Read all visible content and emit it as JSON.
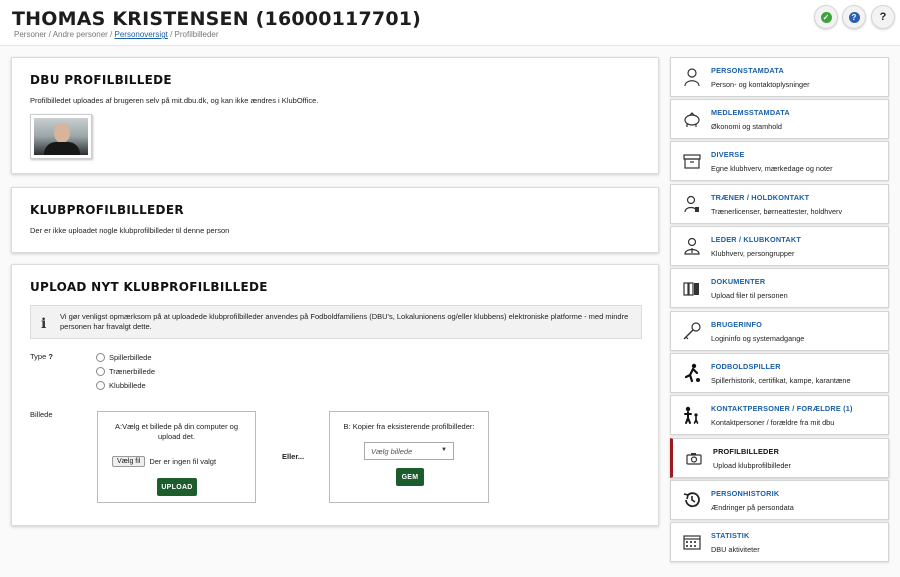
{
  "header": {
    "title": "THOMAS KRISTENSEN (16000117701)",
    "breadcrumb": {
      "part1": "Personer / Andre personer / ",
      "link": "Personoversigt",
      "part3": " / Profilbilleder"
    },
    "buttons": [
      {
        "icon": "green-circle-icon",
        "color": "#3aa33a",
        "glyph": "✓"
      },
      {
        "icon": "help-circle-icon",
        "color": "#2b5fb0",
        "glyph": "?"
      },
      {
        "icon": "question-icon",
        "glyph": "?"
      }
    ]
  },
  "panels": {
    "dbu": {
      "title": "DBU PROFILBILLEDE",
      "text": "Profilbilledet uploades af brugeren selv på mit.dbu.dk, og kan ikke ændres i KlubOffice."
    },
    "klub": {
      "title": "KLUBPROFILBILLEDER",
      "text": "Der er ikke uploadet nogle klubprofilbilleder til denne person"
    },
    "upload": {
      "title": "UPLOAD NYT KLUBPROFILBILLEDE",
      "info_line1": "Vi gør venligst opmærksom på at uploadede klubprofilbilleder anvendes på Fodboldfamiliens (DBU's, Lokalunionens og/eller klubbens) elektroniske platforme - med mindre",
      "info_line2": "personen har fravalgt dette.",
      "type_label": "Type",
      "type_help": "?",
      "types": [
        "Spillerbillede",
        "Trænerbillede",
        "Klubbillede"
      ],
      "billede_label": "Billede",
      "box_a_line1": "A:Vælg et billede på din computer og",
      "box_a_line2": "upload det.",
      "file_button": "Vælg fil",
      "file_status": "Der er ingen fil valgt",
      "upload_button": "UPLOAD",
      "eller": "Eller...",
      "box_b_title": "B: Kopier fra eksisterende profilbilleder:",
      "select_placeholder": "Vælg billede",
      "gem_button": "GEM"
    }
  },
  "sidebar": {
    "items": [
      {
        "title": "PERSONSTAMDATA",
        "sub": "Person- og kontaktoplysninger",
        "icon": "person-icon"
      },
      {
        "title": "MEDLEMSSTAMDATA",
        "sub": "Økonomi og stamhold",
        "icon": "piggy-bank-icon"
      },
      {
        "title": "DIVERSE",
        "sub": "Egne klubhverv, mærkedage og noter",
        "icon": "archive-box-icon"
      },
      {
        "title": "TRÆNER / HOLDKONTAKT",
        "sub": "Trænerlicenser, børneattester, holdhverv",
        "icon": "coach-icon"
      },
      {
        "title": "LEDER / KLUBKONTAKT",
        "sub": "Klubhverv, persongrupper",
        "icon": "leader-icon"
      },
      {
        "title": "DOKUMENTER",
        "sub": "Upload filer til personen",
        "icon": "binders-icon"
      },
      {
        "title": "BRUGERINFO",
        "sub": "Logininfo og systemadgange",
        "icon": "key-icon"
      },
      {
        "title": "FODBOLDSPILLER",
        "sub": "Spillerhistorik, certifikat, kampe, karantæne",
        "icon": "football-player-icon"
      },
      {
        "title": "KONTAKTPERSONER / FORÆLDRE (1)",
        "sub": "Kontaktpersoner / forældre fra mit dbu",
        "icon": "parent-child-icon"
      },
      {
        "title": "PROFILBILLEDER",
        "sub": "Upload klubprofilbilleder",
        "icon": "camera-icon",
        "active": true
      },
      {
        "title": "PERSONHISTORIK",
        "sub": "Ændringer på persondata",
        "icon": "history-icon"
      },
      {
        "title": "STATISTIK",
        "sub": "DBU aktiviteter",
        "icon": "calendar-icon"
      }
    ]
  }
}
